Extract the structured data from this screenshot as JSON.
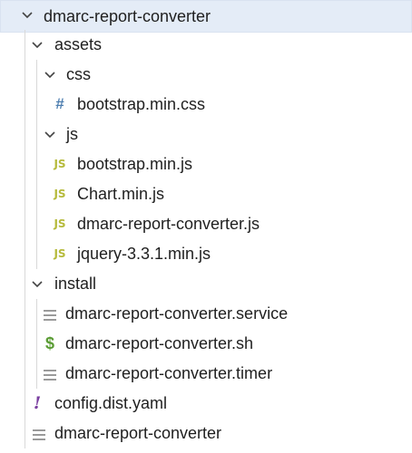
{
  "tree": {
    "root": {
      "label": "dmarc-report-converter",
      "expanded": true
    },
    "assets": {
      "label": "assets",
      "expanded": true
    },
    "css": {
      "label": "css",
      "expanded": true
    },
    "bootstrap_css": {
      "label": "bootstrap.min.css",
      "icon": "#"
    },
    "js": {
      "label": "js",
      "expanded": true
    },
    "bootstrap_js": {
      "label": "bootstrap.min.js",
      "icon": "JS"
    },
    "chart_js": {
      "label": "Chart.min.js",
      "icon": "JS"
    },
    "converter_js": {
      "label": "dmarc-report-converter.js",
      "icon": "JS"
    },
    "jquery_js": {
      "label": "jquery-3.3.1.min.js",
      "icon": "JS"
    },
    "install": {
      "label": "install",
      "expanded": true
    },
    "service": {
      "label": "dmarc-report-converter.service"
    },
    "sh": {
      "label": "dmarc-report-converter.sh",
      "icon": "$"
    },
    "timer": {
      "label": "dmarc-report-converter.timer"
    },
    "config": {
      "label": "config.dist.yaml",
      "icon": "!"
    },
    "binary": {
      "label": "dmarc-report-converter"
    }
  },
  "colors": {
    "selection": "#e4ecf7",
    "js_icon": "#b5ba3a",
    "css_icon": "#4f7fb0",
    "sh_icon": "#5a9c34",
    "yaml_icon": "#7a3fa0"
  }
}
